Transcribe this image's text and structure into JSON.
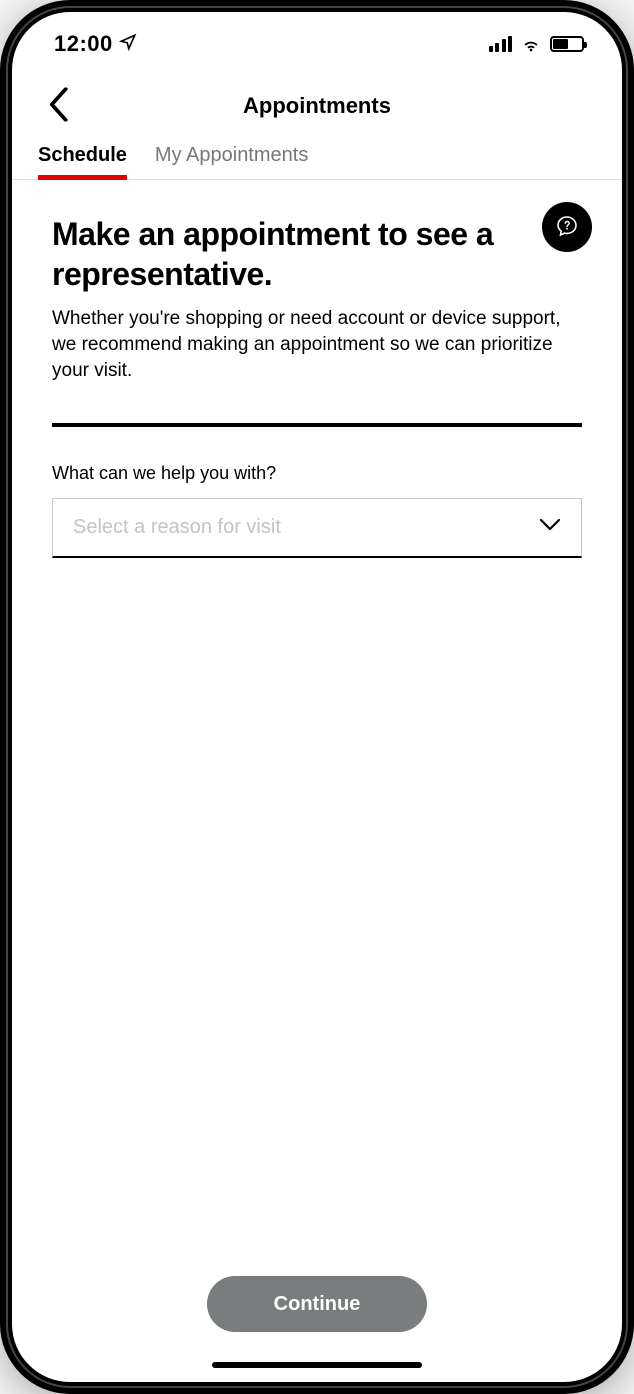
{
  "status": {
    "time": "12:00"
  },
  "header": {
    "title": "Appointments"
  },
  "tabs": {
    "items": [
      {
        "label": "Schedule"
      },
      {
        "label": "My Appointments"
      }
    ]
  },
  "main": {
    "heading": "Make an appointment to see a representative.",
    "subheading": "Whether you're shopping or need account or device support, we recommend making an appointment so we can prioritize your visit.",
    "field_label": "What can we help you with?",
    "select_placeholder": "Select a reason for visit"
  },
  "footer": {
    "continue_label": "Continue"
  }
}
